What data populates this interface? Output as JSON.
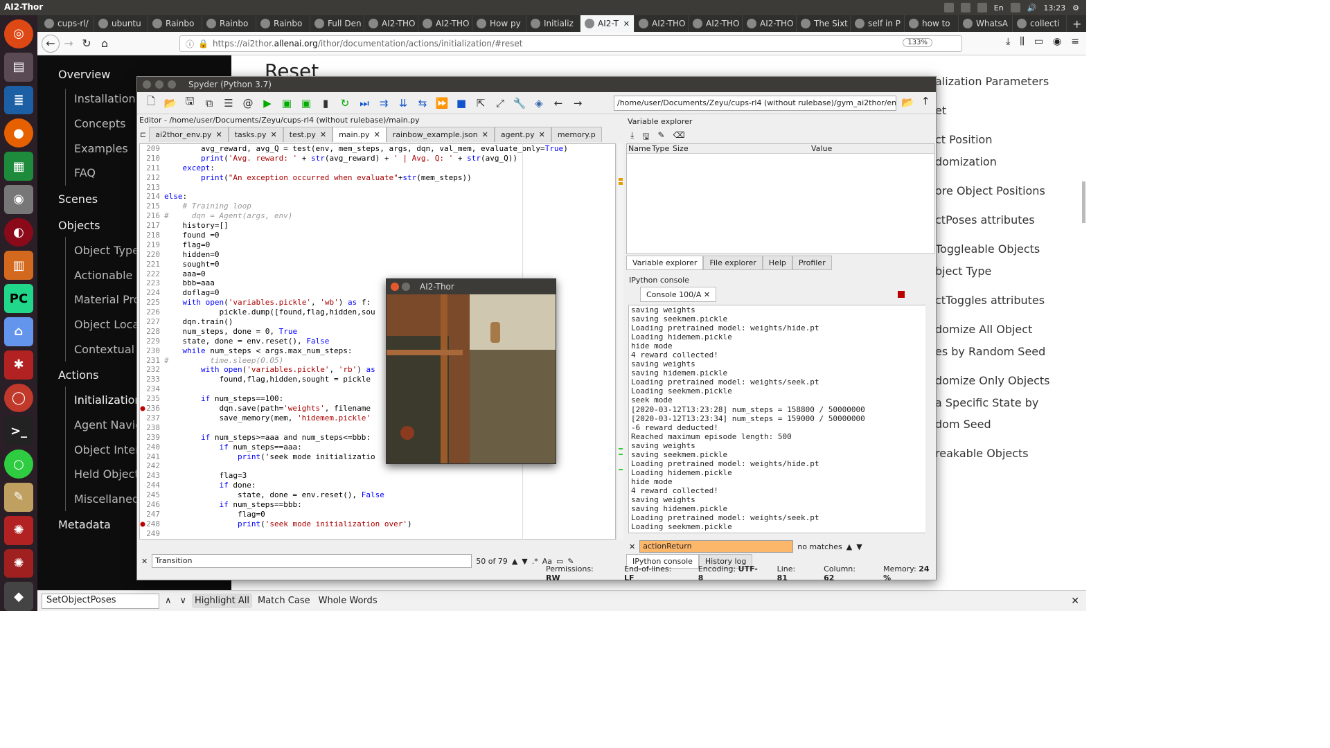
{
  "topbar": {
    "title": "AI2-Thor",
    "keyboard": "En",
    "time": "13:23"
  },
  "browser": {
    "tabs": [
      "cups-rl/",
      "ubuntu",
      "Rainbo",
      "Rainbo",
      "Rainbo",
      "Full Den",
      "AI2-THO",
      "AI2-THO",
      "How py",
      "Initializ",
      "AI2-T",
      "AI2-THO",
      "AI2-THO",
      "AI2-THO",
      "The Sixt",
      "self in P",
      "how to",
      "WhatsA",
      "collecti"
    ],
    "url_prefix": "https://ai2thor.",
    "url_domain": "allenai.org",
    "url_suffix": "/ithor/documentation/actions/initialization/#reset",
    "zoom": "133%"
  },
  "docs": {
    "heading": "Reset",
    "sidebar": {
      "overview": "Overview",
      "installation": "Installation",
      "concepts": "Concepts",
      "examples": "Examples",
      "faq": "FAQ",
      "scenes": "Scenes",
      "objects": "Objects",
      "object_types": "Object Types",
      "actionable": "Actionable P",
      "material": "Material Pro",
      "object_locat": "Object Locat",
      "contextual": "Contextual I",
      "actions": "Actions",
      "initialization": "Initialization",
      "agent_navig": "Agent Naviga",
      "object_inter": "Object Intera",
      "held_object": "Held Object",
      "miscellaneous": "Miscellaneou",
      "metadata": "Metadata"
    },
    "toc": [
      "alization Parameters",
      "et",
      "ct Position",
      "domization",
      "ore Object Positions",
      "ctPoses attributes",
      "Toggleable Objects",
      "bject Type",
      "ctToggles attributes",
      "domize All Object",
      "es by Random Seed",
      "domize Only Objects",
      "a Specific State by",
      "dom Seed",
      "reakable Objects"
    ]
  },
  "findbar": {
    "value": "SetObjectPoses",
    "highlight": "Highlight All",
    "match_case": "Match Case",
    "whole_words": "Whole Words"
  },
  "spyder": {
    "title": "Spyder (Python 3.7)",
    "path": "/home/user/Documents/Zeyu/cups-rl4 (without rulebase)/gym_ai2thor/envs",
    "editor_label": "Editor - /home/user/Documents/Zeyu/cups-rl4 (without rulebase)/main.py",
    "tabs": [
      "ai2thor_env.py",
      "tasks.py",
      "test.py",
      "main.py",
      "rainbow_example.json",
      "agent.py",
      "memory.p"
    ],
    "code": [
      [
        "209",
        "        avg_reward, avg_Q = test(env, mem_steps, args, dqn, val_mem, evaluate_only=True)"
      ],
      [
        "210",
        "        print('Avg. reward: ' + str(avg_reward) + ' | Avg. Q: ' + str(avg_Q))"
      ],
      [
        "211",
        "    except:"
      ],
      [
        "212",
        "        print(\"An exception occurred when evaluate\"+str(mem_steps))"
      ],
      [
        "213",
        ""
      ],
      [
        "214",
        "else:"
      ],
      [
        "215",
        "    # Training loop"
      ],
      [
        "216",
        "#     dqn = Agent(args, env)"
      ],
      [
        "217",
        "    history=[]"
      ],
      [
        "218",
        "    found =0"
      ],
      [
        "219",
        "    flag=0"
      ],
      [
        "220",
        "    hidden=0"
      ],
      [
        "221",
        "    sought=0"
      ],
      [
        "222",
        "    aaa=0"
      ],
      [
        "223",
        "    bbb=aaa"
      ],
      [
        "224",
        "    doflag=0"
      ],
      [
        "225",
        "    with open('variables.pickle', 'wb') as f:"
      ],
      [
        "226",
        "            pickle.dump([found,flag,hidden,sou"
      ],
      [
        "227",
        "    dqn.train()"
      ],
      [
        "228",
        "    num_steps, done = 0, True"
      ],
      [
        "229",
        "    state, done = env.reset(), False"
      ],
      [
        "230",
        "    while num_steps < args.max_num_steps:"
      ],
      [
        "231",
        "#         time.sleep(0.05)"
      ],
      [
        "232",
        "        with open('variables.pickle', 'rb') as"
      ],
      [
        "233",
        "            found,flag,hidden,sought = pickle"
      ],
      [
        "234",
        ""
      ],
      [
        "235",
        "        if num_steps==100:"
      ],
      [
        "236",
        "            dqn.save(path='weights', filename"
      ],
      [
        "237",
        "            save_memory(mem, 'hidemem.pickle'"
      ],
      [
        "238",
        ""
      ],
      [
        "239",
        "        if num_steps>=aaa and num_steps<=bbb:"
      ],
      [
        "240",
        "            if num_steps==aaa:"
      ],
      [
        "241",
        "                print('seek mode initializatio"
      ],
      [
        "242",
        ""
      ],
      [
        "243",
        "            flag=3"
      ],
      [
        "244",
        "            if done:"
      ],
      [
        "245",
        "                state, done = env.reset(), False"
      ],
      [
        "246",
        "            if num_steps==bbb:"
      ],
      [
        "247",
        "                flag=0"
      ],
      [
        "248",
        "                print('seek mode initialization over')"
      ],
      [
        "249",
        ""
      ]
    ],
    "editor_search": "Transition",
    "search_count": "50 of 79",
    "var_explorer": "Variable explorer",
    "var_cols": [
      "Name",
      "Type",
      "Size",
      "Value"
    ],
    "pane_tabs": [
      "Variable explorer",
      "File explorer",
      "Help",
      "Profiler"
    ],
    "ipython_label": "IPython console",
    "console_tab": "Console 100/A",
    "console": [
      "saving weights",
      "saving seekmem.pickle",
      "Loading pretrained model: weights/hide.pt",
      "Loading hidemem.pickle",
      "hide mode",
      "4 reward collected!",
      "saving weights",
      "saving hidemem.pickle",
      "Loading pretrained model: weights/seek.pt",
      "Loading seekmem.pickle",
      "seek mode",
      "[2020-03-12T13:23:28] num_steps = 158800 / 50000000",
      "[2020-03-12T13:23:34] num_steps = 159000 / 50000000",
      "-6 reward deducted!",
      "Reached maximum episode length: 500",
      "saving weights",
      "saving seekmem.pickle",
      "Loading pretrained model: weights/hide.pt",
      "Loading hidemem.pickle",
      "hide mode",
      "4 reward collected!",
      "saving weights",
      "saving hidemem.pickle",
      "Loading pretrained model: weights/seek.pt",
      "Loading seekmem.pickle"
    ],
    "console_search": "actionReturn",
    "no_matches": "no matches",
    "bottom_tabs": [
      "IPython console",
      "History log"
    ],
    "status": {
      "permissions_label": "Permissions:",
      "permissions": "RW",
      "eol_label": "End-of-lines:",
      "eol": "LF",
      "encoding_label": "Encoding:",
      "encoding": "UTF-8",
      "line_label": "Line:",
      "line": "81",
      "col_label": "Column:",
      "col": "62",
      "mem_label": "Memory:",
      "mem": "24 %"
    }
  },
  "ai2thor_window": {
    "title": "AI2-Thor"
  }
}
